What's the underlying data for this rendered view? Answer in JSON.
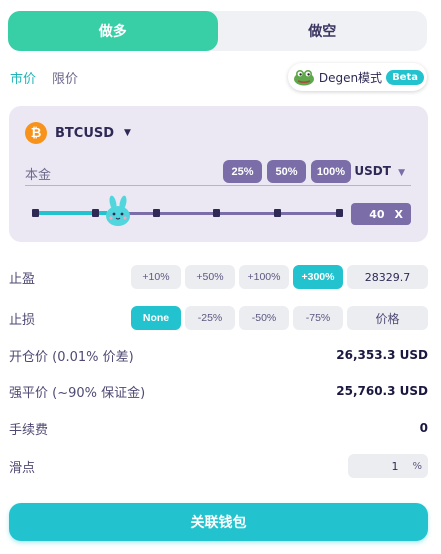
{
  "side": {
    "long_label": "做多",
    "short_label": "做空",
    "active": "long"
  },
  "order_types": [
    {
      "label": "市价",
      "active": true
    },
    {
      "label": "限价",
      "active": false
    }
  ],
  "degen": {
    "label": "Degen模式",
    "badge": "Beta"
  },
  "asset": {
    "symbol": "BTCUSD",
    "icon": "bitcoin-icon",
    "icon_glyph": "₿"
  },
  "principal": {
    "label": "本金",
    "percent_buttons": [
      "25%",
      "50%",
      "100%"
    ],
    "currency": "USDT"
  },
  "leverage": {
    "value": "40",
    "suffix": "X",
    "slider_fraction": 0.2
  },
  "take_profit": {
    "label": "止盈",
    "options": [
      "+10%",
      "+50%",
      "+100%",
      "+300%"
    ],
    "active_index": 3,
    "price": "28329.7"
  },
  "stop_loss": {
    "label": "止损",
    "options": [
      "None",
      "-25%",
      "-50%",
      "-75%"
    ],
    "active_index": 0,
    "price_placeholder": "价格"
  },
  "entry_price": {
    "label": "开仓价 (0.01% 价差)",
    "value": "26,353.3 USD"
  },
  "liquidation_price": {
    "label": "强平价 (~90% 保证金)",
    "value": "25,760.3 USD"
  },
  "fee": {
    "label": "手续费",
    "value": "0"
  },
  "slippage": {
    "label": "滑点",
    "value": "1",
    "unit": "%"
  },
  "connect_wallet_label": "关联钱包",
  "colors": {
    "long_active": "#38cfa6",
    "accent": "#22c3ce",
    "purple": "#7a6da8",
    "bitcoin": "#f7931a"
  }
}
